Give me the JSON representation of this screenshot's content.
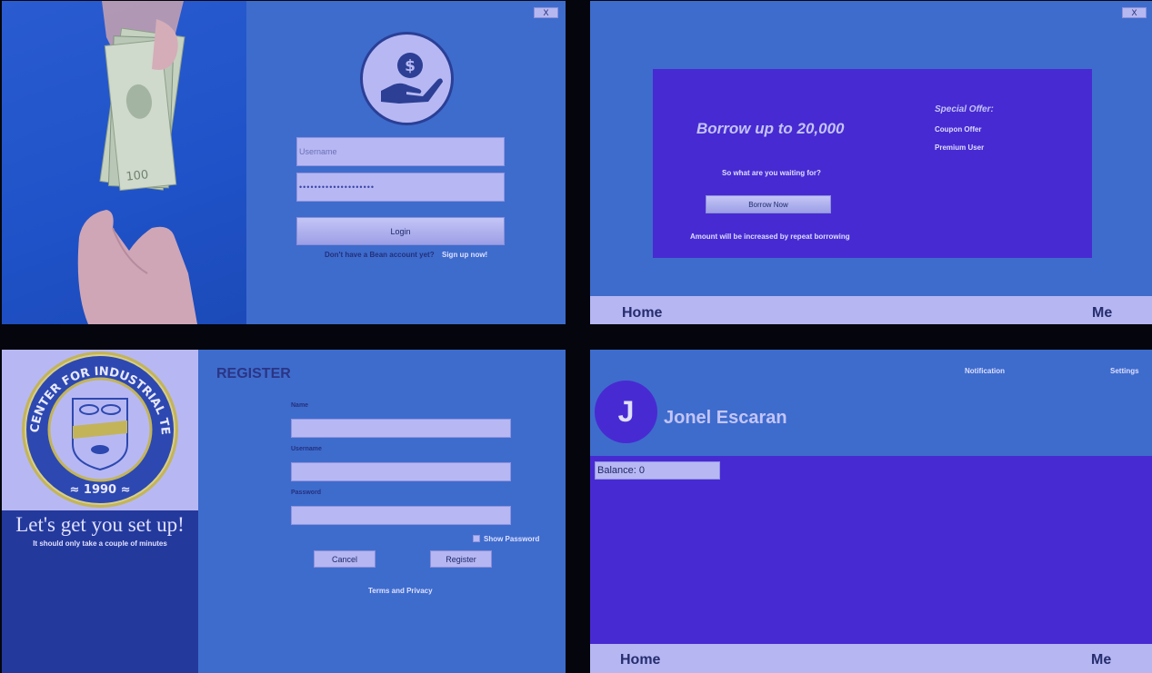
{
  "login": {
    "close_label": "X",
    "username_placeholder": "Username",
    "password_value": "••••••••••••••••••••",
    "login_label": "Login",
    "no_account_text": "Don't have a Bean account yet?",
    "signup_link": "Sign up now!",
    "logo_icon": "dollar-hand-icon"
  },
  "home": {
    "close_label": "X",
    "headline": "Borrow up to 20,000",
    "subline": "So what are you waiting for?",
    "borrow_button": "Borrow Now",
    "footnote": "Amount will be increased by repeat borrowing",
    "special_offer_title": "Special Offer:",
    "offers": [
      "Coupon Offer",
      "Premium User"
    ],
    "nav_home": "Home",
    "nav_me": "Me"
  },
  "register": {
    "title": "REGISTER",
    "tagline": "Let's get you set up!",
    "subtagline": "It should only take a couple of minutes",
    "name_label": "Name",
    "username_label": "Username",
    "password_label": "Password",
    "show_password_label": "Show Password",
    "cancel_label": "Cancel",
    "register_label": "Register",
    "terms_link": "Terms and Privacy",
    "seal_text_top": "CENTER FOR INDUSTRIAL TECHNOLOGY AND ENTERPRISE",
    "seal_year": "1990"
  },
  "profile": {
    "notification_label": "Notification",
    "settings_label": "Settings",
    "avatar_initial": "J",
    "user_name": "Jonel Escaran",
    "balance_value": "Balance: 0",
    "nav_home": "Home",
    "nav_me": "Me"
  },
  "colors": {
    "panel_blue": "#3e6ccd",
    "purple": "#482ad2",
    "lavender": "#b7b8f3",
    "dark_navy": "#24399c"
  }
}
